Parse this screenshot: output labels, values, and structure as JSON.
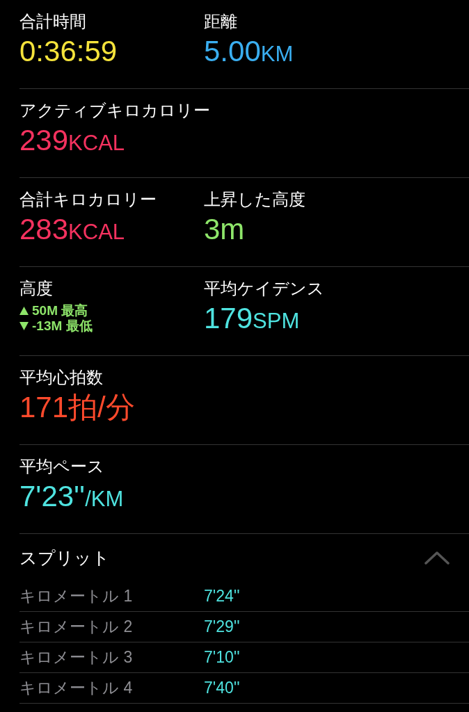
{
  "metric_rows": [
    {
      "cells": [
        {
          "kind": "value",
          "label": "合計時間",
          "value": "0:36:59",
          "color": "#f5e33b"
        },
        {
          "kind": "value",
          "label": "距離",
          "value": "5.00",
          "unit": "KM",
          "color": "#3aaef0"
        }
      ]
    },
    {
      "cells": [
        {
          "kind": "value",
          "label": "アクティブキロカロリー",
          "value": "239",
          "unit": "KCAL",
          "color": "#f5325f"
        }
      ]
    },
    {
      "cells": [
        {
          "kind": "value",
          "label": "合計キロカロリー",
          "value": "283",
          "unit": "KCAL",
          "color": "#f5325f"
        },
        {
          "kind": "value",
          "label": "上昇した高度",
          "value": "3m",
          "color": "#8ee56a"
        }
      ]
    },
    {
      "cells": [
        {
          "kind": "range",
          "label": "高度",
          "color": "#8ee56a",
          "lines": [
            {
              "kind": "up",
              "value": "50M",
              "caption": "最高"
            },
            {
              "kind": "down",
              "value": "-13M",
              "caption": "最低"
            }
          ]
        },
        {
          "kind": "value",
          "label": "平均ケイデンス",
          "value": "179",
          "unit": "SPM",
          "color": "#4fe3e0"
        }
      ]
    },
    {
      "cells": [
        {
          "kind": "value",
          "label": "平均心拍数",
          "value": "171拍/分",
          "color": "#ff4a2c"
        }
      ]
    },
    {
      "cells": [
        {
          "kind": "value",
          "label": "平均ペース",
          "value": "7'23''",
          "unit": "/KM",
          "color": "#4fe3e0"
        }
      ]
    }
  ],
  "splits": {
    "title": "スプリット",
    "expanded": true,
    "rows": [
      {
        "label": "キロメートル 1",
        "pace": "7'24''"
      },
      {
        "label": "キロメートル 2",
        "pace": "7'29''"
      },
      {
        "label": "キロメートル 3",
        "pace": "7'10''"
      },
      {
        "label": "キロメートル 4",
        "pace": "7'40''"
      }
    ]
  }
}
